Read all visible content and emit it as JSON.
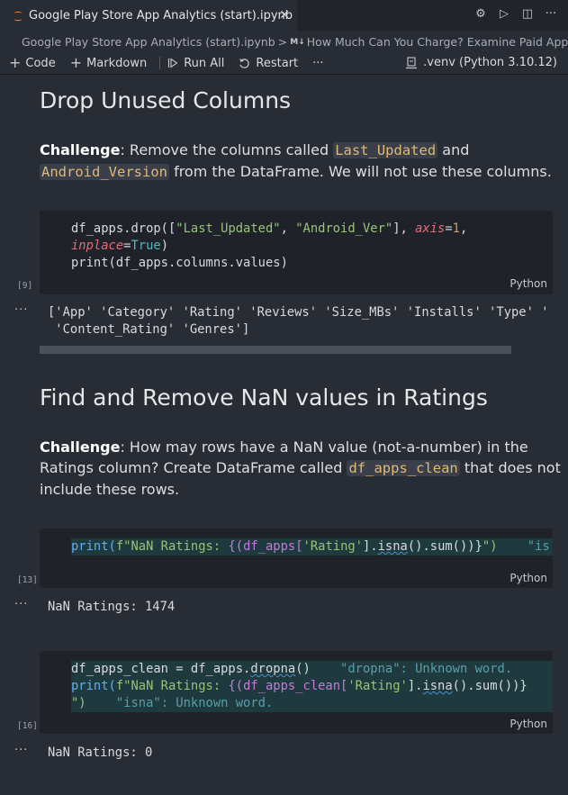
{
  "tab": {
    "title": "Google Play Store App Analytics (start).ipynb",
    "close": "✕"
  },
  "tab_actions": {
    "settings": "⚙",
    "run": "▷",
    "split": "◫",
    "more": "···"
  },
  "breadcrumb": {
    "file": "Google Play Store App Analytics (start).ipynb",
    "sep": ">",
    "md_badge": "M↓",
    "section": "How Much Can You Charge? Examine Paid App P"
  },
  "toolbar": {
    "code": "Code",
    "markdown": "Markdown",
    "run_all": "Run All",
    "restart": "Restart",
    "more": "···",
    "kernel": ".venv (Python 3.10.12)"
  },
  "section1": {
    "title": "Drop Unused Columns",
    "challenge_label": "Challenge",
    "text_a": ": Remove the columns called ",
    "code_a": "Last_Updated",
    "text_b": " and ",
    "code_b": "Android_Version",
    "text_c": " from the DataFrame. We will not use these columns."
  },
  "cell9": {
    "count": "[9]",
    "lang": "Python",
    "line1a": "df_apps.drop([",
    "line1_s1": "\"Last_Updated\"",
    "line1_c": ", ",
    "line1_s2": "\"Android_Ver\"",
    "line1_d": "], ",
    "line1_param": "axis",
    "line1_eq": "=",
    "line1_num": "1",
    "line1_end": ",",
    "line2_param": "inplace",
    "line2_eq": "=",
    "line2_kw": "True",
    "line2_end": ")",
    "line3": "print(df_apps.columns.values)",
    "output_line1": "['App' 'Category' 'Rating' 'Reviews' 'Size_MBs' 'Installs' 'Type' '",
    "output_line2": " 'Content_Rating' 'Genres']"
  },
  "section2": {
    "title": "Find and Remove NaN values in Ratings",
    "challenge_label": "Challenge",
    "text_a": ": How may rows have a NaN value (not-a-number) in the Ratings column? Create DataFrame called ",
    "code_a": "df_apps_clean",
    "text_b": " that does not include these rows."
  },
  "cell13": {
    "count": "[13]",
    "lang": "Python",
    "p1": "print(",
    "p2": "f\"NaN Ratings: ",
    "p3": "{(df_apps[",
    "p4": "'Rating'",
    "p5": "].",
    "p6": "isna",
    "p7": "().sum())}",
    "p8": "\")",
    "ghost": "    \"is",
    "output": "NaN Ratings: 1474"
  },
  "cell16": {
    "count": "[16]",
    "lang": "Python",
    "l1a": "df_apps_clean = df_apps.",
    "l1b": "dropna",
    "l1c": "()",
    "l1ghost": "    \"dropna\": Unknown word.",
    "l2a": "print(",
    "l2b": "f\"NaN Ratings: ",
    "l2c": "{(df_apps_clean[",
    "l2d": "'Rating'",
    "l2e": "].",
    "l2f": "isna",
    "l2g": "().sum())}",
    "l3a": "\")",
    "l3ghost": "    \"isna\": Unknown word.",
    "output": "NaN Ratings: 0"
  },
  "output_dots": "···"
}
